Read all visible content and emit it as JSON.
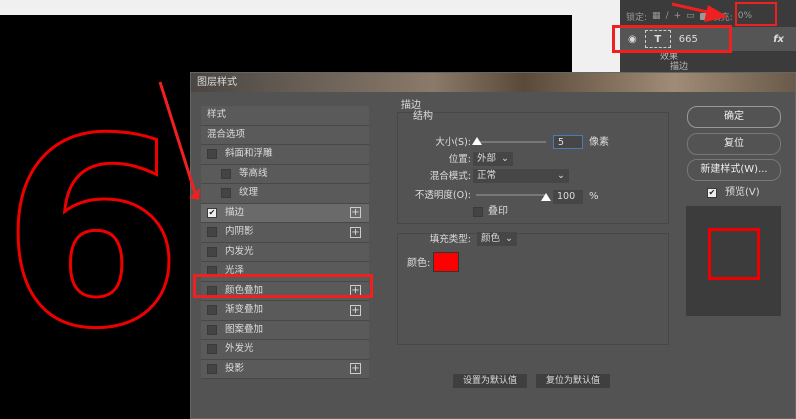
{
  "canvas": {
    "glyph": "6"
  },
  "layers_panel": {
    "lock_label": "锁定:",
    "fill_label": "填充:",
    "fill_value": "0%",
    "layer_name": "665",
    "fx": "fx",
    "effects_label": "效果",
    "effect_stroke": "描边"
  },
  "dialog": {
    "title": "图层样式",
    "styles_list": [
      {
        "label": "样式",
        "checkbox": false,
        "checked": false,
        "plus": false,
        "indent": false
      },
      {
        "label": "混合选项",
        "checkbox": false,
        "checked": false,
        "plus": false,
        "indent": false
      },
      {
        "label": "斜面和浮雕",
        "checkbox": true,
        "checked": false,
        "plus": false,
        "indent": false
      },
      {
        "label": "等高线",
        "checkbox": true,
        "checked": false,
        "plus": false,
        "indent": true
      },
      {
        "label": "纹理",
        "checkbox": true,
        "checked": false,
        "plus": false,
        "indent": true
      },
      {
        "label": "描边",
        "checkbox": true,
        "checked": true,
        "plus": true,
        "indent": false
      },
      {
        "label": "内阴影",
        "checkbox": true,
        "checked": false,
        "plus": true,
        "indent": false
      },
      {
        "label": "内发光",
        "checkbox": true,
        "checked": false,
        "plus": false,
        "indent": false
      },
      {
        "label": "光泽",
        "checkbox": true,
        "checked": false,
        "plus": false,
        "indent": false
      },
      {
        "label": "颜色叠加",
        "checkbox": true,
        "checked": false,
        "plus": true,
        "indent": false
      },
      {
        "label": "渐变叠加",
        "checkbox": true,
        "checked": false,
        "plus": true,
        "indent": false
      },
      {
        "label": "图案叠加",
        "checkbox": true,
        "checked": false,
        "plus": false,
        "indent": false
      },
      {
        "label": "外发光",
        "checkbox": true,
        "checked": false,
        "plus": false,
        "indent": false
      },
      {
        "label": "投影",
        "checkbox": true,
        "checked": false,
        "plus": true,
        "indent": false
      }
    ],
    "stroke": {
      "section_title": "描边",
      "group_title": "结构",
      "size_label": "大小(S):",
      "size_value": "5",
      "size_unit": "像素",
      "size_fraction": 0.02,
      "position_label": "位置:",
      "position_value": "外部",
      "blend_label": "混合模式:",
      "blend_value": "正常",
      "opacity_label": "不透明度(O):",
      "opacity_value": "100",
      "opacity_unit": "%",
      "opacity_fraction": 1.0,
      "overprint_label": "叠印",
      "fill_type_label": "填充类型:",
      "fill_type_value": "颜色",
      "color_label": "颜色:",
      "color": "#ff0000",
      "set_default": "设置为默认值",
      "reset_default": "复位为默认值"
    },
    "buttons": {
      "ok": "确定",
      "reset": "复位",
      "new_style": "新建样式(W)...",
      "preview_label": "预览(V)",
      "preview_checked": true
    }
  },
  "colors": {
    "highlight": "#f02020",
    "stroke": "#ff0000"
  }
}
